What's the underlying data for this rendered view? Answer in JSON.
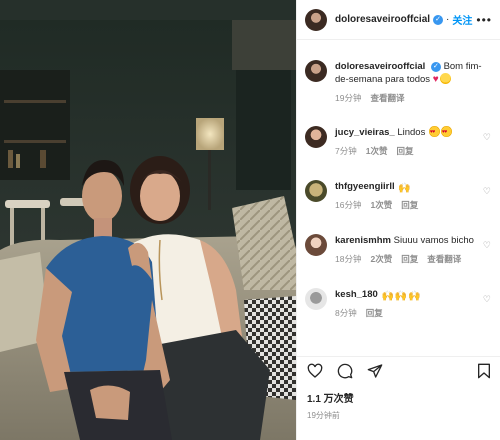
{
  "post": {
    "username": "doloresaveirooffcial",
    "follow_label": "关注",
    "more_label": "•••",
    "caption": {
      "username": "doloresaveirooffcial",
      "text": "Bom fim-de-semana para todos",
      "time": "19分钟",
      "translate_label": "查看翻译"
    },
    "comments": [
      {
        "username": "jucy_vieiras_",
        "text": "Lindos",
        "time": "7分钟",
        "likes": "1次赞",
        "reply_label": "回复",
        "translate_label": ""
      },
      {
        "username": "thfgyeengiirll",
        "text": "",
        "time": "16分钟",
        "likes": "1次赞",
        "reply_label": "回复",
        "translate_label": ""
      },
      {
        "username": "karenismhm",
        "text": "Siuuu vamos bicho",
        "time": "18分钟",
        "likes": "2次赞",
        "reply_label": "回复",
        "translate_label": "查看翻译"
      },
      {
        "username": "kesh_180",
        "text": "",
        "time": "8分钟",
        "likes": "",
        "reply_label": "回复",
        "translate_label": ""
      }
    ],
    "likes_count": "1.1 万次赞",
    "post_time": "19分钟前"
  },
  "colors": {
    "link_blue": "#0095f6",
    "verified_blue": "#3897f0",
    "muted_gray": "#8e8e8e",
    "heart_red": "#e0245e"
  },
  "icons": [
    "more-icon",
    "heart-icon",
    "comment-icon",
    "share-icon",
    "bookmark-icon",
    "verified-icon"
  ]
}
